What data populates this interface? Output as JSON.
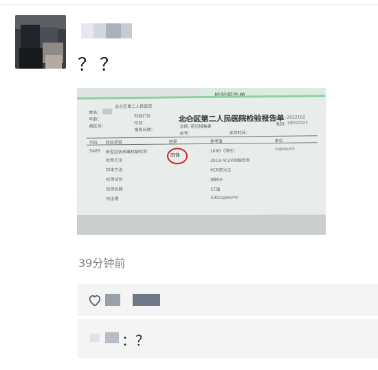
{
  "post": {
    "text": "？？",
    "timestamp": "39分钟前"
  },
  "photo": {
    "report_title": "北仑区第二人民医院检验报告单",
    "report_title_behind": "检验报告单",
    "header_left": "北仑区第二人民医院",
    "fields": {
      "name_label": "姓名：",
      "age_label": "年龄：",
      "dept_label": "病区号：",
      "sex_label": "性别：",
      "hospital_label": "科别：",
      "dept_value": "门诊",
      "ward_label": "床号：",
      "sample_label": "样本：",
      "sample_value": "咽拭子",
      "diagnosis_label": "诊断：",
      "diagnosis_value": "密切接触者",
      "apply_label": "申请医生：",
      "barcode_label": "编号：",
      "barcode_value": "2022102",
      "specimen_label": "条码：",
      "specimen_value": "10010322",
      "remark_label": "采样时间：",
      "order_label": "代码",
      "receive_label": "报告日期："
    },
    "table": {
      "headers": [
        "代码",
        "检验项目",
        "结果",
        "参考值",
        "单位"
      ],
      "row_code": "SARS",
      "row_item": "新型冠状病毒核酸检测",
      "row_result": "阳性",
      "ref_lines": [
        "1000（阴性）",
        "2019-nCoV核酸检测",
        "采样方法",
        "检验仪器",
        "结果"
      ],
      "unit": "copies/ml",
      "left_lines": [
        "检测方法",
        "样本方法",
        "检测试剂",
        "检测仪器",
        "检出限"
      ],
      "ref_values": [
        "PCR荧光法",
        "咽拭子",
        "实时荧光PCR",
        "CT值",
        "500copies/ml"
      ]
    }
  },
  "comment": {
    "text": "：？"
  },
  "icons": {
    "heart": "heart-outline-icon"
  },
  "colors": {
    "timestamp": "#808080",
    "panel_bg": "#f4f4f4",
    "result_circle": "#d22020"
  }
}
